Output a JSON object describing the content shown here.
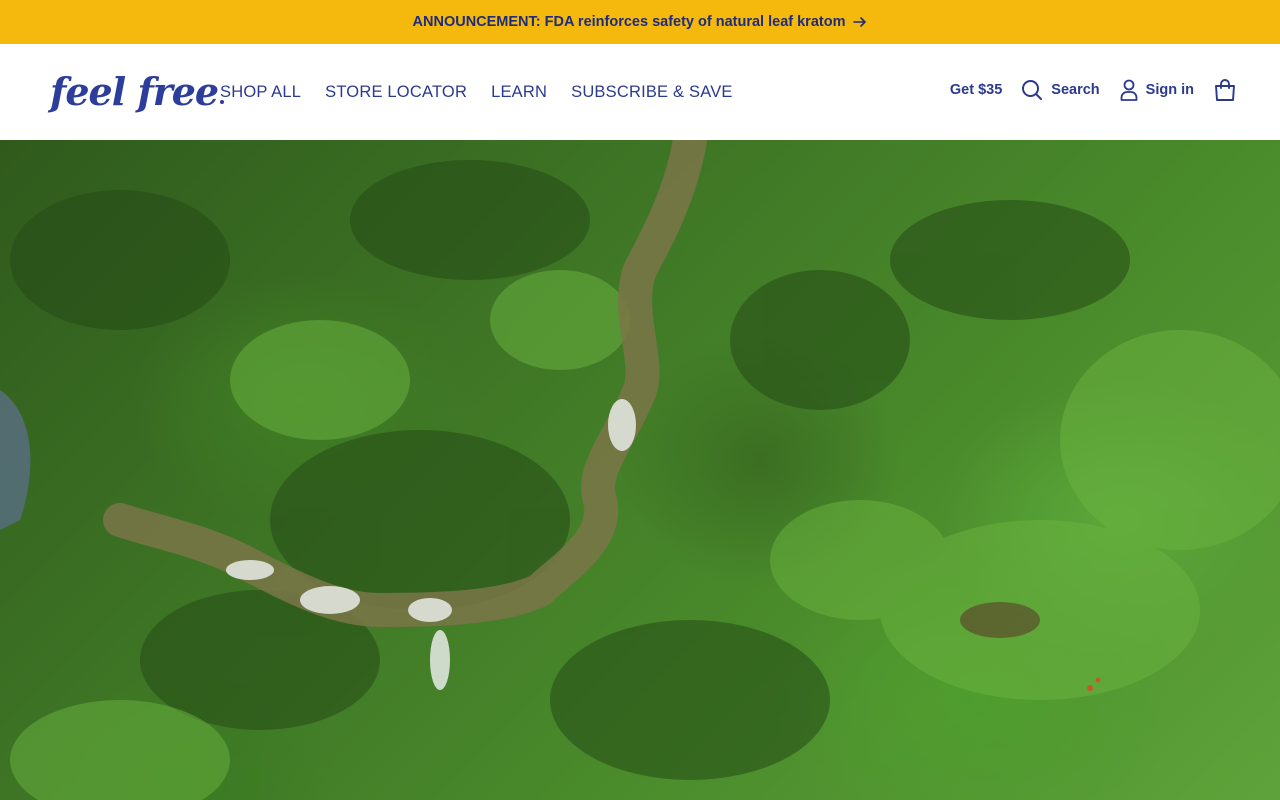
{
  "announcement": {
    "text": "ANNOUNCEMENT: FDA reinforces safety of natural leaf kratom",
    "icon": "arrow-right-icon",
    "background": "#f5b80c"
  },
  "header": {
    "logo_text": "feel free",
    "nav": [
      "SHOP ALL",
      "STORE LOCATOR",
      "LEARN",
      "SUBSCRIBE & SAVE"
    ],
    "utility": {
      "promo_label": "Get $35",
      "search_label": "Search",
      "signin_label": "Sign in",
      "cart_icon": "shopping-bag-icon"
    }
  },
  "hero": {
    "image": "aerial view of green rainforest with winding river and waterfalls"
  },
  "colors": {
    "brand": "#2b3a8f",
    "accent": "#f5b80c"
  }
}
